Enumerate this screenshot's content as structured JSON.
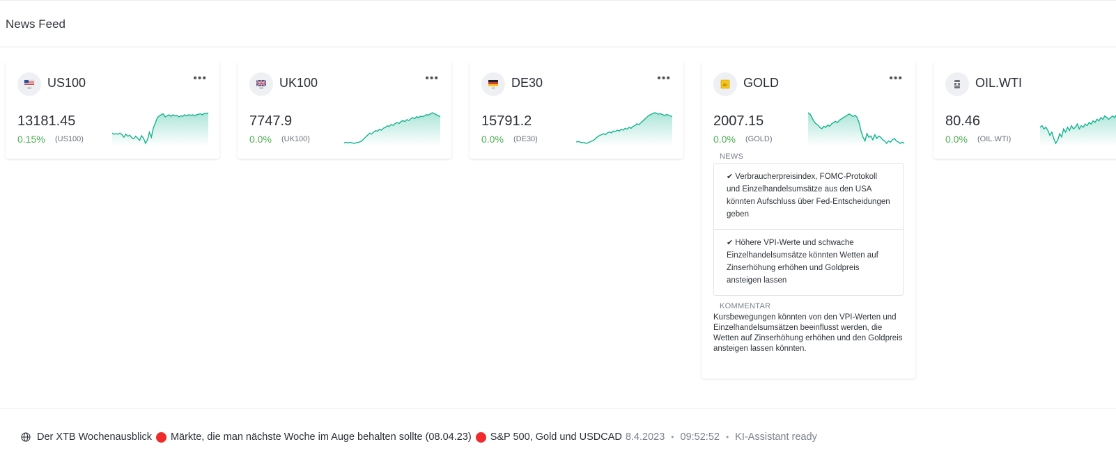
{
  "header": {
    "title": "News Feed"
  },
  "cards": [
    {
      "symbol": "US100",
      "price": "13181.45",
      "change": "0.15%",
      "ticker": "(US100)",
      "flag": "us-flag-icon",
      "spark": [
        48,
        46,
        47,
        46,
        48,
        45,
        40,
        46,
        42,
        44,
        39,
        37,
        42,
        38,
        34,
        43,
        38,
        28,
        35,
        50,
        40,
        58,
        68,
        78,
        82,
        84,
        86,
        80,
        82,
        84,
        81,
        84,
        82,
        83,
        80,
        82,
        81,
        84,
        82,
        84,
        83,
        84,
        82,
        84,
        85,
        86,
        84,
        87,
        86,
        88
      ]
    },
    {
      "symbol": "UK100",
      "price": "7747.9",
      "change": "0.0%",
      "ticker": "(UK100)",
      "flag": "uk-flag-icon",
      "spark": [
        20,
        21,
        20,
        21,
        20,
        19,
        20,
        21,
        22,
        24,
        28,
        32,
        36,
        40,
        38,
        42,
        45,
        44,
        48,
        46,
        50,
        52,
        55,
        54,
        58,
        56,
        60,
        62,
        60,
        64,
        66,
        64,
        68,
        66,
        70,
        72,
        70,
        74,
        72,
        75,
        74,
        76,
        78,
        77,
        80,
        82,
        80,
        78,
        76,
        74
      ]
    },
    {
      "symbol": "DE30",
      "price": "15791.2",
      "change": "0.0%",
      "ticker": "(DE30)",
      "flag": "de-flag-icon",
      "spark": [
        22,
        23,
        22,
        20,
        21,
        19,
        20,
        22,
        24,
        26,
        30,
        34,
        36,
        38,
        40,
        38,
        42,
        44,
        42,
        46,
        45,
        48,
        46,
        50,
        48,
        52,
        50,
        54,
        52,
        56,
        58,
        62,
        60,
        64,
        68,
        72,
        76,
        80,
        82,
        84,
        86,
        85,
        83,
        84,
        82,
        80,
        82,
        81,
        79,
        78
      ]
    },
    {
      "symbol": "GOLD",
      "price": "2007.15",
      "change": "0.0%",
      "ticker": "(GOLD)",
      "flag": "gold-bar-icon",
      "spark": [
        90,
        88,
        82,
        76,
        72,
        70,
        66,
        64,
        68,
        66,
        70,
        68,
        72,
        74,
        76,
        74,
        78,
        80,
        82,
        84,
        86,
        88,
        86,
        84,
        86,
        82,
        74,
        60,
        50,
        44,
        56,
        50,
        52,
        46,
        54,
        48,
        52,
        50,
        46,
        44,
        40,
        44,
        42,
        46,
        48,
        44,
        42,
        40,
        42,
        40
      ]
    },
    {
      "symbol": "OIL.WTI",
      "price": "80.46",
      "change": "0.0%",
      "ticker": "(OIL.WTI)",
      "flag": "oil-barrel-icon",
      "spark": [
        60,
        62,
        58,
        60,
        56,
        50,
        54,
        46,
        40,
        44,
        52,
        48,
        58,
        54,
        60,
        56,
        62,
        58,
        60,
        64,
        58,
        62,
        60,
        64,
        62,
        66,
        64,
        68,
        66,
        70,
        68,
        72,
        70,
        74,
        72,
        70,
        72,
        74,
        72,
        76,
        74,
        72,
        74,
        76,
        74,
        78,
        76,
        74,
        76,
        78
      ]
    }
  ],
  "gold_details": {
    "news_label": "NEWS",
    "news": [
      "Verbraucherpreisindex, FOMC-Protokoll und Einzelhandelsumsätze aus den USA könnten Aufschluss über Fed-Entscheidungen geben",
      "Höhere VPI-Werte und schwache Einzelhandelsumsätze könnten Wetten auf Zinserhöhung erhöhen und Goldpreis ansteigen lassen"
    ],
    "comment_label": "KOMMENTAR",
    "comment": "Kursbewegungen könnten von den VPI-Werten und Einzelhandelsumsätzen beeinflusst werden, die Wetten auf Zinserhöhung erhöhen und den Goldpreis ansteigen lassen könnten."
  },
  "footer": {
    "part1": "Der XTB Wochenausblick",
    "part2": "Märkte, die man nächste Woche im Auge behalten sollte (08.04.23)",
    "part3": "S&P 500, Gold und USDCAD",
    "date": "8.4.2023",
    "time": "09:52:52",
    "status": "KI-Assistant ready"
  },
  "colors": {
    "accent": "#13b48f",
    "positive": "#4caf50",
    "alert": "#ef2b2b"
  }
}
